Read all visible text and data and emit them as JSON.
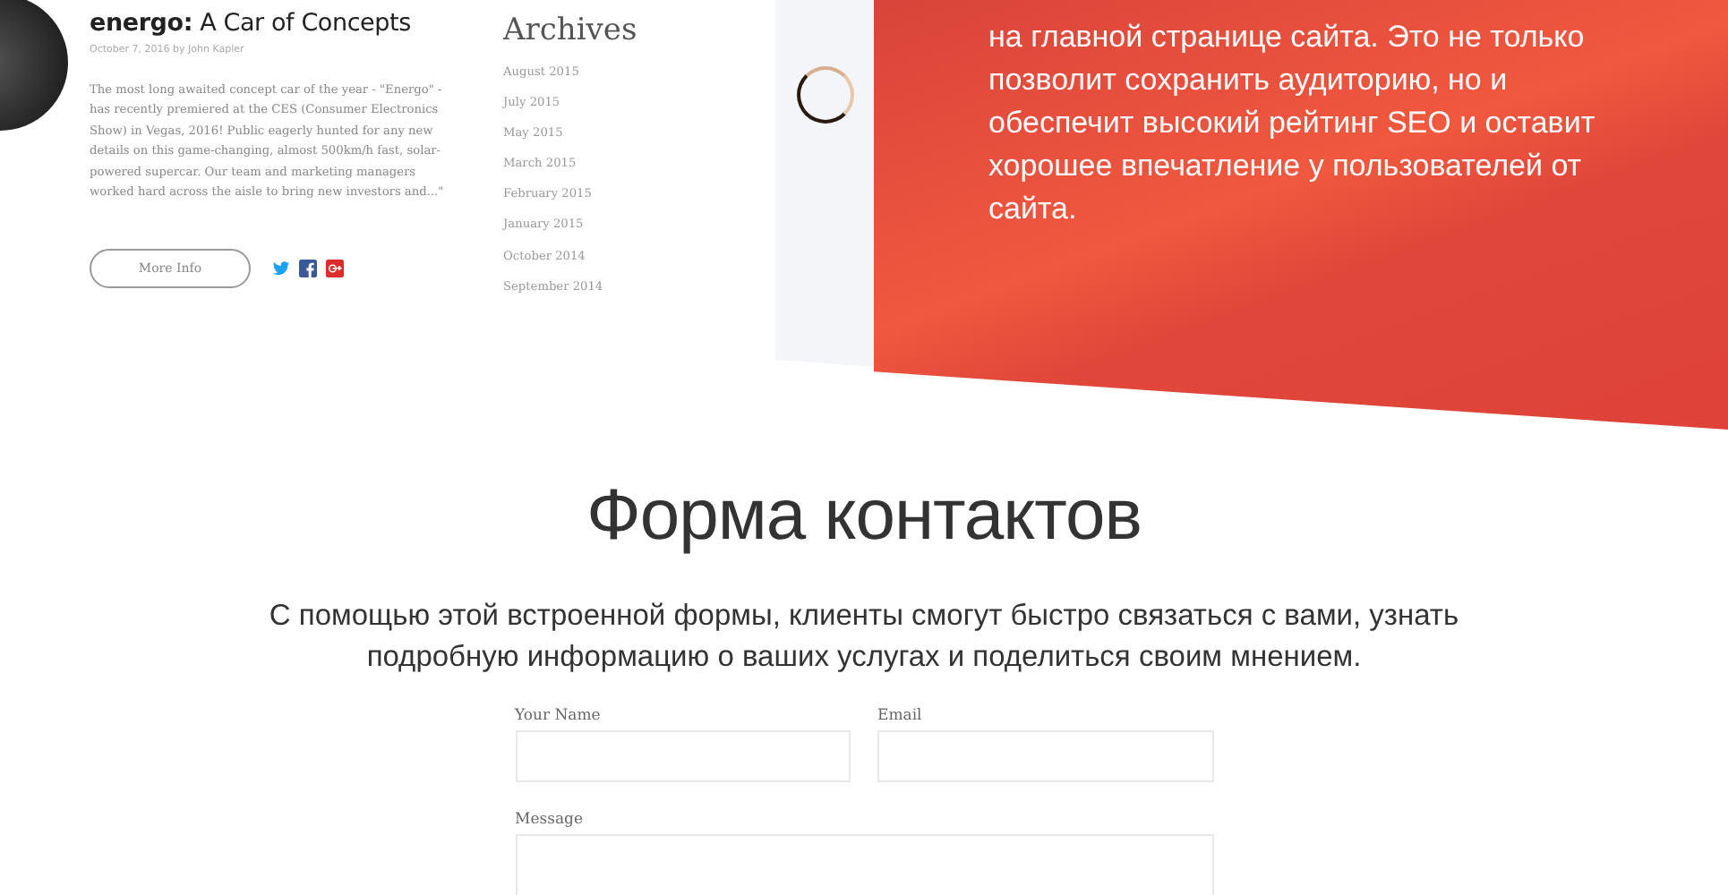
{
  "blog_post": {
    "title": "**energo:** A Car of Concepts",
    "meta": "October 7, 2016 by John Kapler",
    "excerpt": "The most long awaited concept car of the year - \"Energo\" - has recently premiered at the CES (Consumer Electronics Show) in Vegas, 2016! Public eagerly hunted for any new details on this game-changing, almost 500km/h fast, solar-powered supercar. Our team and marketing managers worked hard across the aisle to bring new investors and...\"",
    "button": "More Info"
  },
  "archives": {
    "title": "Archives",
    "items": [
      "August 2015",
      "July 2015",
      "May 2015",
      "March 2015",
      "February 2015",
      "January 2015",
      "October 2014",
      "September 2014"
    ]
  },
  "promo": {
    "text": "на главной странице сайта. Это не только позволит сохранить аудиторию, но и обеспечит высокий рейтинг SEO и оставит хорошее впечатление у пользователей от сайта."
  },
  "contact": {
    "title": "Форма контактов",
    "description": "С помощью этой встроенной формы, клиенты смогут быстро связаться с вами, узнать подробную информацию о ваших услугах и поделиться своим мнением.",
    "fields": [
      {
        "label": "Your Name"
      },
      {
        "label": "Email"
      }
    ],
    "message_label": "Message"
  }
}
